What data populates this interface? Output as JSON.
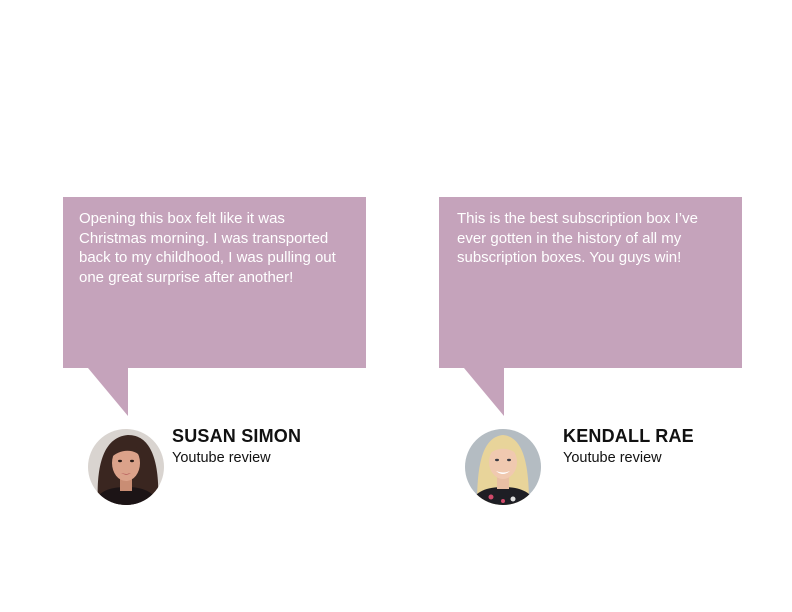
{
  "colors": {
    "bubble": "#c5a3bb",
    "bubble_text": "#ffffff",
    "name_text": "#111111"
  },
  "testimonials": [
    {
      "quote": "Opening this box felt like it was Christmas morning. I was transported back to my childhood, I was pulling out one great surprise after another!",
      "name": "SUSAN SIMON",
      "source": "Youtube review",
      "avatar_icon": "reviewer-photo-icon"
    },
    {
      "quote": "This is the best subscription box I’ve ever gotten in the history of all my subscription boxes. You guys win!",
      "name": "KENDALL RAE",
      "source": "Youtube review",
      "avatar_icon": "reviewer-photo-icon"
    }
  ]
}
